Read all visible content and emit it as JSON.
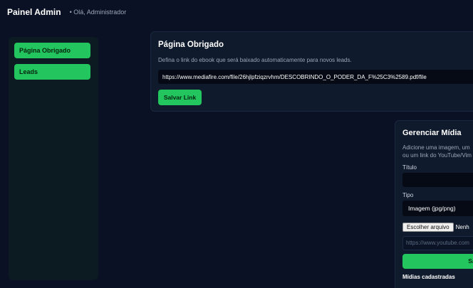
{
  "header": {
    "title": "Painel Admin",
    "greeting": "• Olá, Administrador"
  },
  "sidebar": {
    "items": [
      {
        "label": "Página Obrigado"
      },
      {
        "label": "Leads"
      }
    ]
  },
  "thankyou": {
    "title": "Página Obrigado",
    "description": "Defina o link do ebook que será baixado automaticamente para novos leads.",
    "link_value": "https://www.mediafire.com/file/26hjlpfziqzrvhm/DESCOBRINDO_O_PODER_DA_F%25C3%2589.pdf/file",
    "save_label": "Salvar Link"
  },
  "media": {
    "title": "Gerenciar Mídia",
    "description_line1": "Adicione uma imagem, um",
    "description_line2": "ou um link do YouTube/Vim",
    "title_label": "Título",
    "type_label": "Tipo",
    "type_selected": "Imagem (jpg/png)",
    "file_button": "Escolher arquivo",
    "file_none": "Nenh",
    "url_placeholder": "https://www.youtube.com",
    "save_label": "Sal",
    "list_title": "Mídias cadastradas"
  },
  "colors": {
    "background": "#0a1124",
    "card": "#0f1a2c",
    "accent": "#22c55e"
  }
}
